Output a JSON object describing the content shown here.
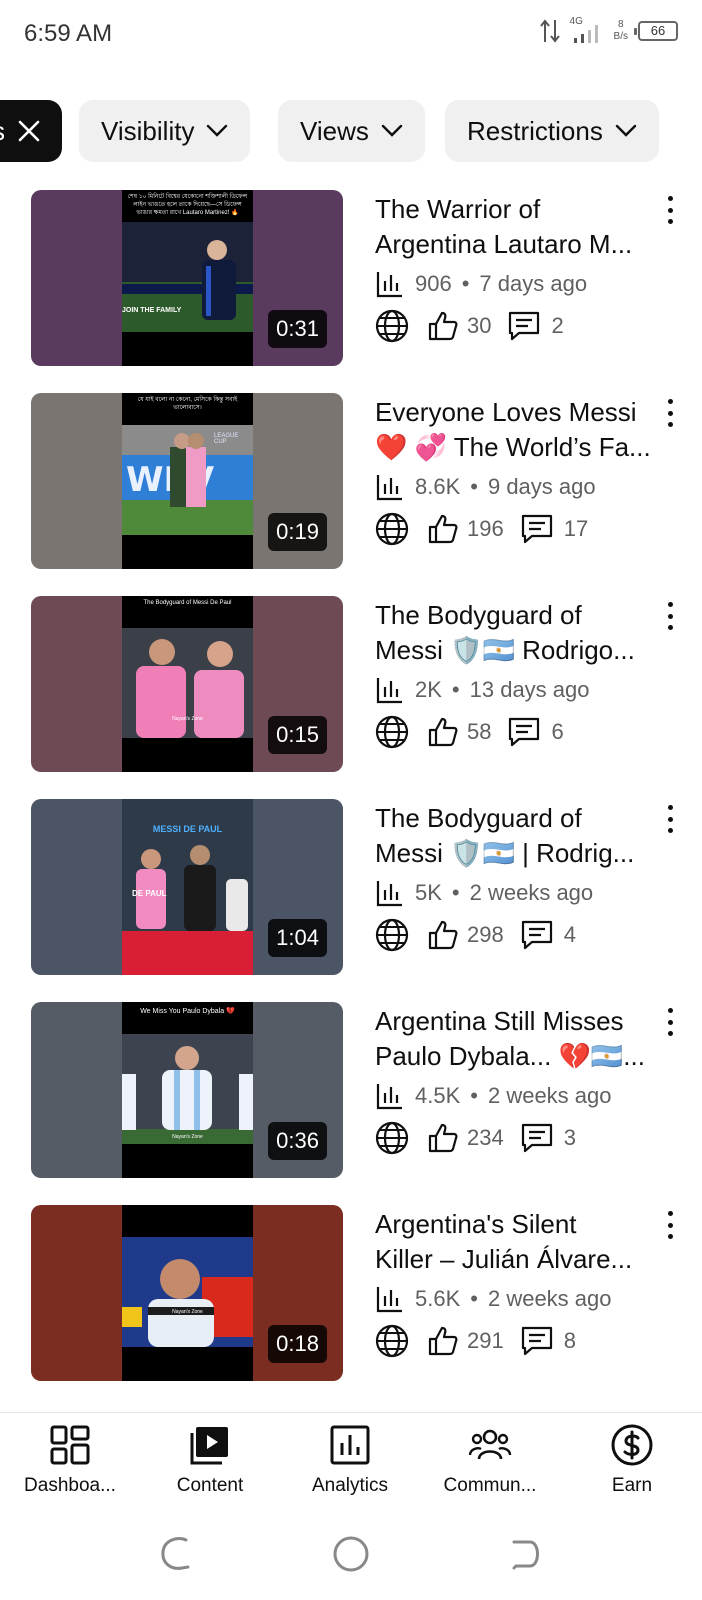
{
  "status_bar": {
    "time": "6:59 AM",
    "network": "4G",
    "speed_value": "8",
    "speed_unit": "B/s",
    "battery": "66"
  },
  "filters": [
    {
      "label": "s",
      "selected": true
    },
    {
      "label": "Visibility"
    },
    {
      "label": "Views"
    },
    {
      "label": "Restrictions"
    }
  ],
  "videos": [
    {
      "title_line1": "The Warrior of",
      "title_line2": "Argentina Lautaro M...",
      "views": "906",
      "age": "7 days ago",
      "likes": "30",
      "comments": "2",
      "duration": "0:31",
      "thumb_caption": "শেষ ১০ মিনিটে বিশ্বের যেকোনো শক্তিশালী ডিফেন্স লাইন ভাঙতে হলে তাকে দিয়েছে—সে ডিফেন্স ভাঙার ক্ষমতা রাখে Lautaro Martinez! 🔥",
      "thumb_text": "JOIN THE FAMILY"
    },
    {
      "title_line1": "Everyone Loves Messi",
      "title_line2": "❤️ 💞 The World’s Fa...",
      "views": "8.6K",
      "age": "9 days ago",
      "likes": "196",
      "comments": "17",
      "duration": "0:19",
      "thumb_caption": "যে যাই বলো না কেনো, মেসিকে কিন্তু সবাই ভালোবাসে।",
      "thumb_text": "LEAGUE CUP"
    },
    {
      "title_line1": "The Bodyguard of",
      "title_line2": "Messi 🛡️🇦🇷  Rodrigo...",
      "views": "2K",
      "age": "13 days ago",
      "likes": "58",
      "comments": "6",
      "duration": "0:15",
      "thumb_caption": "The Bodyguard of Messi De Paul",
      "thumb_text": "Nayan's Zone"
    },
    {
      "title_line1": "The Bodyguard of",
      "title_line2": "Messi 🛡️🇦🇷 | Rodrig...",
      "views": "5K",
      "age": "2 weeks ago",
      "likes": "298",
      "comments": "4",
      "duration": "1:04",
      "thumb_caption": "MESSI   DE PAUL",
      "thumb_text": "DE PAUL"
    },
    {
      "title_line1": "Argentina Still Misses",
      "title_line2": "Paulo Dybala... 💔🇦🇷...",
      "views": "4.5K",
      "age": "2 weeks ago",
      "likes": "234",
      "comments": "3",
      "duration": "0:36",
      "thumb_caption": "We Miss You Paulo Dybala 💔",
      "thumb_text": "Nayan's Zone"
    },
    {
      "title_line1": "Argentina's Silent",
      "title_line2": "Killer – Julián Álvare...",
      "views": "5.6K",
      "age": "2 weeks ago",
      "likes": "291",
      "comments": "8",
      "duration": "0:18",
      "thumb_caption": "",
      "thumb_text": "Nayan's Zone"
    }
  ],
  "bottom_nav": [
    {
      "label": "Dashboa...",
      "icon": "dashboard-icon"
    },
    {
      "label": "Content",
      "icon": "content-icon"
    },
    {
      "label": "Analytics",
      "icon": "analytics-icon"
    },
    {
      "label": "Commun...",
      "icon": "community-icon"
    },
    {
      "label": "Earn",
      "icon": "earn-icon"
    }
  ],
  "colors": {
    "thumb_bg": [
      "#5b3a5f",
      "#7a7570",
      "#6e4a55",
      "#4c5566",
      "#555c66",
      "#7a2d20"
    ]
  }
}
